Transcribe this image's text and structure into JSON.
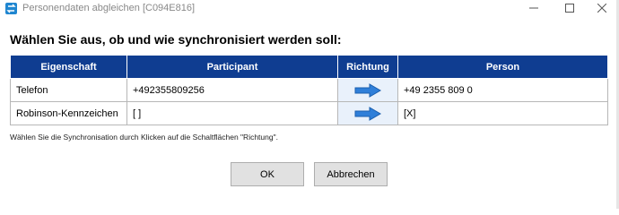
{
  "window": {
    "title": "Personendaten abgleichen [C094E816]"
  },
  "heading": "Wählen Sie aus, ob und wie synchronisiert werden soll:",
  "table": {
    "columns": [
      "Eigenschaft",
      "Participant",
      "Richtung",
      "Person"
    ],
    "rows": [
      {
        "property": "Telefon",
        "participant": "+492355809256",
        "direction": "right-arrow-icon",
        "person": "+49 2355 809 0"
      },
      {
        "property": "Robinson-Kennzeichen",
        "participant": "[ ]",
        "direction": "right-arrow-icon",
        "person": "[X]"
      }
    ]
  },
  "hint": "Wählen Sie die Synchronisation durch Klicken auf die Schaltflächen \"Richtung\".",
  "buttons": {
    "ok": "OK",
    "cancel": "Abbrechen"
  },
  "colors": {
    "header_bg": "#0f3d91",
    "arrow_fill": "#2f7fd9",
    "direction_cell_bg": "#e9f1fb"
  }
}
